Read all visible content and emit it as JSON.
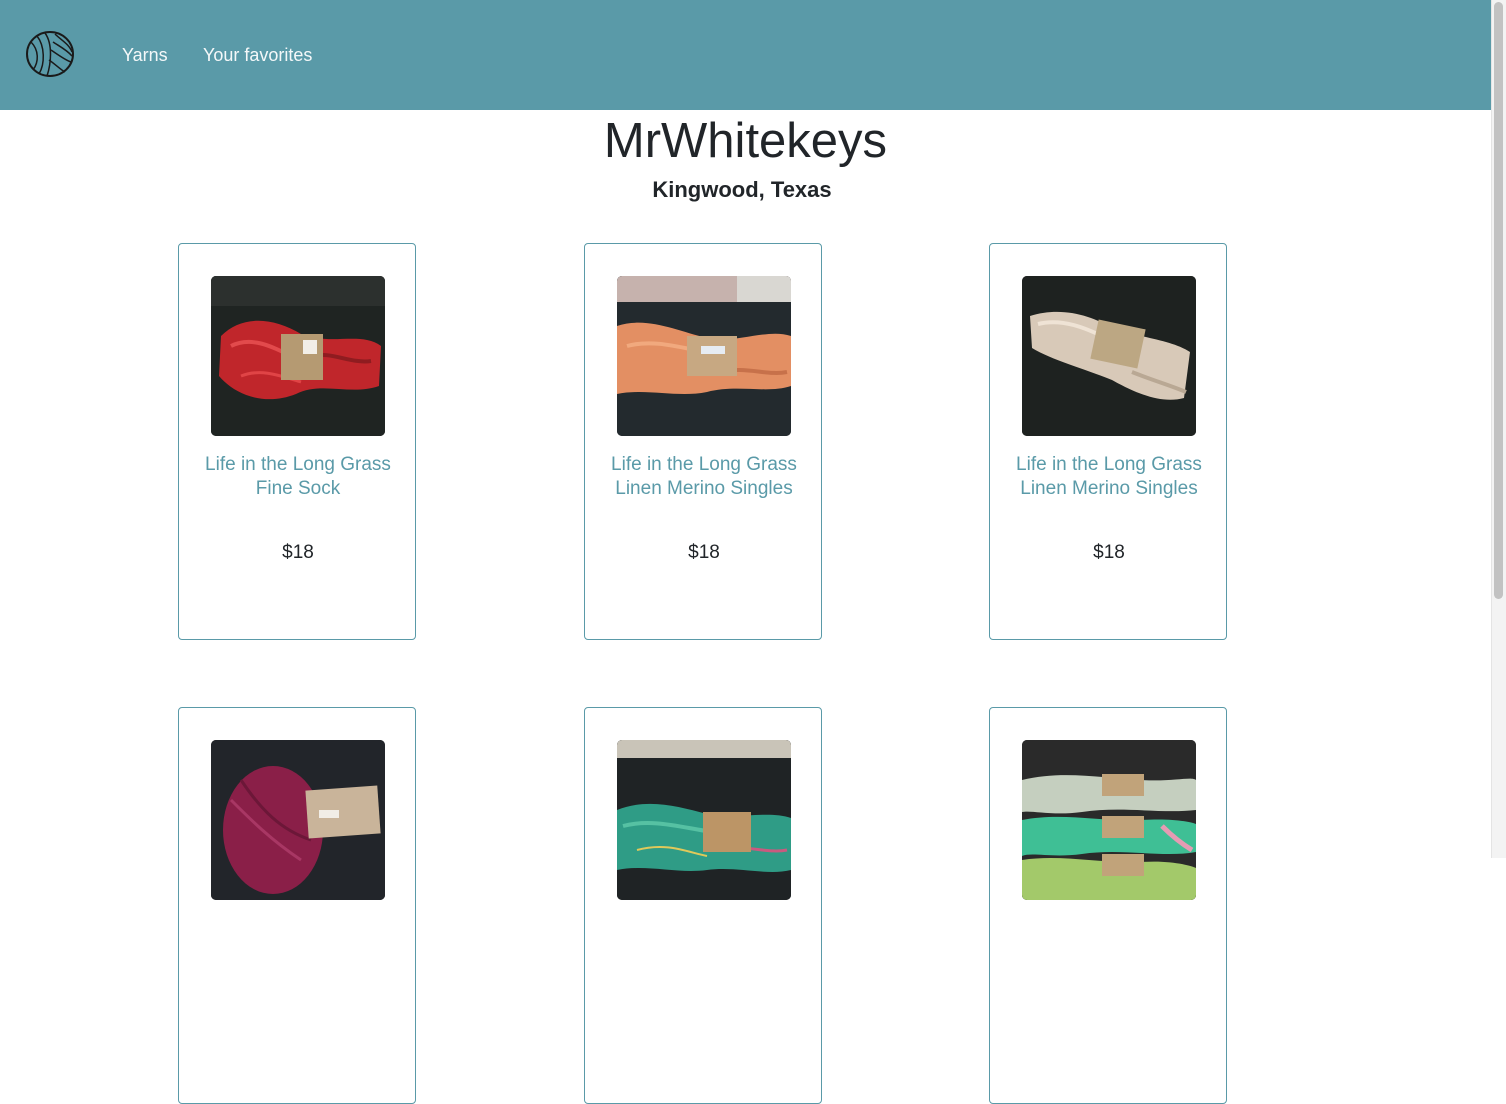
{
  "nav": {
    "logo_icon": "yarn-ball-icon",
    "links": [
      {
        "label": "Yarns"
      },
      {
        "label": "Your favorites"
      }
    ]
  },
  "colors": {
    "brand": "#5a9aa8",
    "text": "#212529"
  },
  "shop": {
    "name": "MrWhitekeys",
    "location": "Kingwood, Texas"
  },
  "products": [
    {
      "name": "Life in the Long Grass Fine Sock",
      "price": "$18",
      "image": "red-yarn-skein"
    },
    {
      "name": "Life in the Long Grass Linen Merino Singles",
      "price": "$18",
      "image": "peach-yarn-skein"
    },
    {
      "name": "Life in the Long Grass Linen Merino Singles",
      "price": "$18",
      "image": "cream-yarn-skein"
    },
    {
      "name": "",
      "price": "",
      "image": "magenta-yarn-cake"
    },
    {
      "name": "",
      "price": "",
      "image": "teal-speckled-yarn-skein"
    },
    {
      "name": "",
      "price": "",
      "image": "multi-green-yarn-skeins"
    }
  ]
}
